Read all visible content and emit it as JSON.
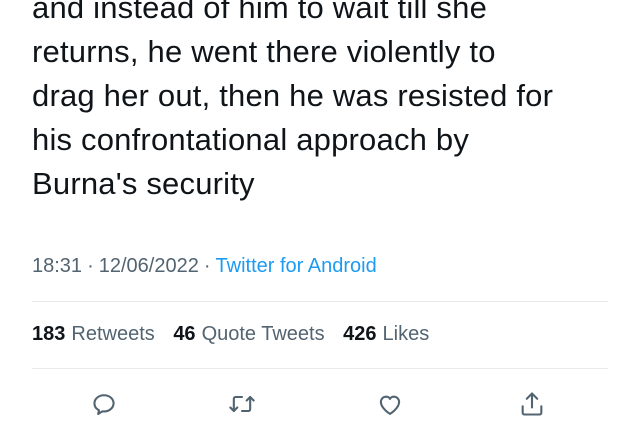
{
  "tweet": {
    "lines": [
      "and instead of him to wait till she",
      "returns, he went there violently to",
      "drag her out, then he was resisted for",
      "his confrontational approach by",
      "Burna's security"
    ]
  },
  "meta": {
    "time": "18:31",
    "separator": "·",
    "date": "12/06/2022",
    "source": "Twitter for Android"
  },
  "stats": {
    "retweets_count": "183",
    "retweets_label": "Retweets",
    "quotes_count": "46",
    "quotes_label": "Quote Tweets",
    "likes_count": "426",
    "likes_label": "Likes"
  },
  "actions": {
    "reply_icon": "reply-icon",
    "retweet_icon": "retweet-icon",
    "like_icon": "heart-icon",
    "share_icon": "share-icon"
  },
  "colors": {
    "text": "#0f1419",
    "muted": "#536471",
    "link": "#1d9bf0",
    "divider": "#e7ebee"
  }
}
